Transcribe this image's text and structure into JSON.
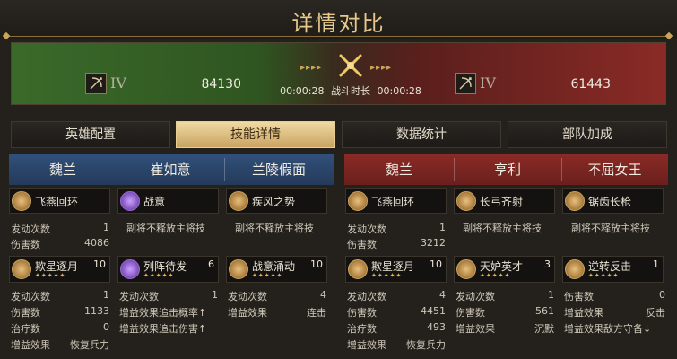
{
  "title": "详情对比",
  "banner": {
    "left": {
      "grade": "IV",
      "power": "84130"
    },
    "right": {
      "grade": "IV",
      "power": "61443"
    },
    "time_left": "00:00:28",
    "time_label": "战斗时长",
    "time_right": "00:00:28"
  },
  "tabs": [
    "英雄配置",
    "技能详情",
    "数据统计",
    "部队加成"
  ],
  "active_tab": "技能详情",
  "left_team": {
    "heroes": [
      "魏兰",
      "崔如意",
      "兰陵假面"
    ],
    "cols": [
      {
        "skill1": {
          "name": "飞燕回环"
        },
        "stats1": [
          {
            "label": "发动次数",
            "value": "1"
          },
          {
            "label": "伤害数",
            "value": "4086"
          }
        ],
        "skill2": {
          "name": "欺星逐月",
          "level": "10"
        },
        "stats2": [
          {
            "label": "发动次数",
            "value": "1"
          },
          {
            "label": "伤害数",
            "value": "1133"
          },
          {
            "label": "治疗数",
            "value": "0"
          },
          {
            "label": "增益效果",
            "value": "恢复兵力"
          }
        ]
      },
      {
        "skill1": {
          "name": "战意"
        },
        "note1": "副将不释放主将技",
        "skill2": {
          "name": "列阵待发",
          "level": "6"
        },
        "stats2": [
          {
            "label": "发动次数",
            "value": "1"
          },
          {
            "label": "增益效果追击概率↑",
            "value": ""
          },
          {
            "label": "增益效果追击伤害↑",
            "value": ""
          }
        ]
      },
      {
        "skill1": {
          "name": "疾风之势"
        },
        "note1": "副将不释放主将技",
        "skill2": {
          "name": "战意涌动",
          "level": "10"
        },
        "stats2": [
          {
            "label": "发动次数",
            "value": "4"
          },
          {
            "label": "增益效果",
            "value": "连击"
          }
        ]
      }
    ]
  },
  "right_team": {
    "heroes": [
      "魏兰",
      "亨利",
      "不屈女王"
    ],
    "cols": [
      {
        "skill1": {
          "name": "飞燕回环"
        },
        "stats1": [
          {
            "label": "发动次数",
            "value": "1"
          },
          {
            "label": "伤害数",
            "value": "3212"
          }
        ],
        "skill2": {
          "name": "欺星逐月",
          "level": "10"
        },
        "stats2": [
          {
            "label": "发动次数",
            "value": "4"
          },
          {
            "label": "伤害数",
            "value": "4451"
          },
          {
            "label": "治疗数",
            "value": "493"
          },
          {
            "label": "增益效果",
            "value": "恢复兵力"
          }
        ]
      },
      {
        "skill1": {
          "name": "长弓齐射"
        },
        "note1": "副将不释放主将技",
        "skill2": {
          "name": "天妒英才",
          "level": "3"
        },
        "stats2": [
          {
            "label": "发动次数",
            "value": "1"
          },
          {
            "label": "伤害数",
            "value": "561"
          },
          {
            "label": "增益效果",
            "value": "沉默"
          }
        ]
      },
      {
        "skill1": {
          "name": "锯齿长枪"
        },
        "note1": "副将不释放主将技",
        "skill2": {
          "name": "逆转反击",
          "level": "1"
        },
        "stats2": [
          {
            "label": "伤害数",
            "value": "0"
          },
          {
            "label": "增益效果",
            "value": "反击"
          },
          {
            "label": "增益效果敌方守备↓",
            "value": ""
          }
        ]
      }
    ]
  },
  "stars": "✦✦✦✦✦",
  "colors": {
    "gold": "#e7c98a",
    "blue_team": "#31507a",
    "red_team": "#8a2a26",
    "active_tab": "#e9cf8e"
  }
}
